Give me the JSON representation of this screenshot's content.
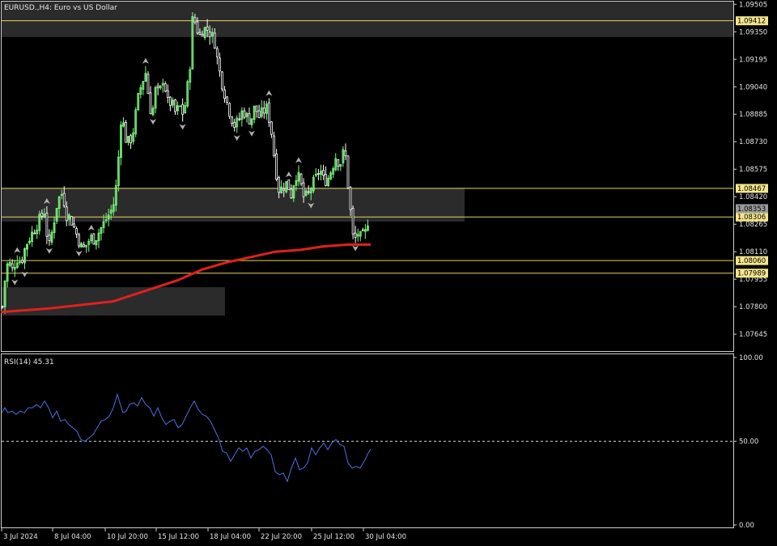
{
  "window": {
    "symbol_title": "EURUSD.,H4:  Euro vs US Dollar"
  },
  "colors": {
    "background": "#000000",
    "bull_candle": "#7CFC7C",
    "bear_candle": "#ffffff",
    "moving_average": "#e02020",
    "level_line": "#e6d36a",
    "zone_fill": "#2b2b2b",
    "rsi_line": "#4f6fe0",
    "fractal": "#b0b0b0",
    "price_tag_bg": "#f4e58c",
    "current_price_tag_bg": "#9a9a9a"
  },
  "chart_data": [
    {
      "type": "candlestick",
      "title": "EURUSD.,H4:  Euro vs US Dollar",
      "ylim": [
        1.0755,
        1.0952
      ],
      "y_ticks": [
        1.09505,
        1.0935,
        1.09195,
        1.0904,
        1.08885,
        1.0873,
        1.08575,
        1.0842,
        1.08265,
        1.0811,
        1.07955,
        1.078,
        1.07645
      ],
      "x_tick_labels": [
        "3 Jul 2024",
        "8 Jul 04:00",
        "10 Jul 20:00",
        "15 Jul 12:00",
        "18 Jul 04:00",
        "22 Jul 20:00",
        "25 Jul 12:00",
        "30 Jul 04:00"
      ],
      "price_levels": [
        1.09412,
        1.08467,
        1.08306,
        1.0806,
        1.07989
      ],
      "current_price": 1.08353,
      "zones": [
        {
          "from": 1.0932,
          "to": 1.0952
        },
        {
          "from": 1.0828,
          "to": 1.0847
        },
        {
          "from": 1.0775,
          "to": 1.0791
        }
      ],
      "series": [
        {
          "name": "",
          "close_path": [
            [
              1,
              1.0768
            ],
            [
              5,
              1.0792
            ],
            [
              10,
              1.0806
            ],
            [
              16,
              1.08
            ],
            [
              20,
              1.0808
            ],
            [
              26,
              1.0805
            ],
            [
              32,
              1.0815
            ],
            [
              38,
              1.082
            ],
            [
              44,
              1.0825
            ],
            [
              50,
              1.083
            ],
            [
              55,
              1.0834
            ],
            [
              60,
              1.0812
            ],
            [
              65,
              1.0824
            ],
            [
              70,
              1.0837
            ],
            [
              75,
              1.0844
            ],
            [
              78,
              1.0843
            ],
            [
              82,
              1.0832
            ],
            [
              87,
              1.083
            ],
            [
              92,
              1.0824
            ],
            [
              97,
              1.0818
            ],
            [
              102,
              1.0812
            ],
            [
              107,
              1.0815
            ],
            [
              112,
              1.0819
            ],
            [
              117,
              1.0818
            ],
            [
              122,
              1.0822
            ],
            [
              127,
              1.0826
            ],
            [
              132,
              1.083
            ],
            [
              137,
              1.0834
            ],
            [
              142,
              1.084
            ],
            [
              147,
              1.0868
            ],
            [
              150,
              1.089
            ],
            [
              155,
              1.0875
            ],
            [
              160,
              1.0872
            ],
            [
              165,
              1.088
            ],
            [
              170,
              1.0896
            ],
            [
              175,
              1.0906
            ],
            [
              180,
              1.0912
            ],
            [
              185,
              1.0893
            ],
            [
              188,
              1.0888
            ],
            [
              192,
              1.0902
            ],
            [
              197,
              1.09
            ],
            [
              202,
              1.091
            ],
            [
              207,
              1.0895
            ],
            [
              212,
              1.0895
            ],
            [
              217,
              1.0889
            ],
            [
              222,
              1.0893
            ],
            [
              227,
              1.0888
            ],
            [
              232,
              1.0905
            ],
            [
              236,
              1.0922
            ],
            [
              238,
              1.0943
            ],
            [
              242,
              1.094
            ],
            [
              246,
              1.0932
            ],
            [
              250,
              1.0936
            ],
            [
              255,
              1.0937
            ],
            [
              260,
              1.0934
            ],
            [
              265,
              1.093
            ],
            [
              270,
              1.0915
            ],
            [
              275,
              1.0905
            ],
            [
              280,
              1.0896
            ],
            [
              285,
              1.0888
            ],
            [
              290,
              1.0882
            ],
            [
              295,
              1.0885
            ],
            [
              300,
              1.0891
            ],
            [
              305,
              1.0887
            ],
            [
              310,
              1.0885
            ],
            [
              315,
              1.0893
            ],
            [
              320,
              1.0887
            ],
            [
              325,
              1.089
            ],
            [
              330,
              1.0892
            ],
            [
              335,
              1.088
            ],
            [
              340,
              1.086
            ],
            [
              345,
              1.0845
            ],
            [
              350,
              1.0848
            ],
            [
              355,
              1.085
            ],
            [
              360,
              1.0843
            ],
            [
              365,
              1.0855
            ],
            [
              370,
              1.0852
            ],
            [
              375,
              1.0842
            ],
            [
              380,
              1.0842
            ],
            [
              385,
              1.0848
            ],
            [
              390,
              1.0852
            ],
            [
              395,
              1.0858
            ],
            [
              400,
              1.0851
            ],
            [
              405,
              1.0852
            ],
            [
              410,
              1.0858
            ],
            [
              415,
              1.0865
            ],
            [
              420,
              1.086
            ],
            [
              425,
              1.0868
            ],
            [
              428,
              1.0862
            ],
            [
              431,
              1.0842
            ],
            [
              434,
              1.083
            ],
            [
              437,
              1.0815
            ],
            [
              440,
              1.082
            ],
            [
              443,
              1.0822
            ],
            [
              446,
              1.0818
            ],
            [
              449,
              1.082
            ],
            [
              452,
              1.0822
            ],
            [
              455,
              1.083
            ],
            [
              458,
              1.0835
            ]
          ]
        },
        {
          "name": "",
          "ma_path": [
            [
              1,
              1.0777
            ],
            [
              30,
              1.0778
            ],
            [
              60,
              1.0779
            ],
            [
              100,
              1.0781
            ],
            [
              140,
              1.0783
            ],
            [
              180,
              1.0789
            ],
            [
              220,
              1.0795
            ],
            [
              250,
              1.0801
            ],
            [
              280,
              1.0805
            ],
            [
              310,
              1.0808
            ],
            [
              340,
              1.0811
            ],
            [
              370,
              1.0812
            ],
            [
              400,
              1.0814
            ],
            [
              430,
              1.0815
            ],
            [
              458,
              1.0815
            ]
          ]
        }
      ]
    },
    {
      "type": "line",
      "title": "RSI(14) 45.31",
      "ylim": [
        0,
        100
      ],
      "y_ticks": [
        100.0,
        50.0,
        0.0
      ],
      "reference_level": 50,
      "series": [
        {
          "name": "",
          "values_path": [
            [
              2,
              67
            ],
            [
              6,
              70
            ],
            [
              10,
              67
            ],
            [
              15,
              68
            ],
            [
              20,
              66
            ],
            [
              25,
              68
            ],
            [
              30,
              67
            ],
            [
              35,
              70
            ],
            [
              40,
              70
            ],
            [
              45,
              72
            ],
            [
              50,
              70
            ],
            [
              55,
              74
            ],
            [
              60,
              70
            ],
            [
              65,
              64
            ],
            [
              70,
              68
            ],
            [
              75,
              62
            ],
            [
              80,
              63
            ],
            [
              85,
              60
            ],
            [
              90,
              58
            ],
            [
              95,
              56
            ],
            [
              100,
              51
            ],
            [
              105,
              50
            ],
            [
              110,
              52
            ],
            [
              115,
              54
            ],
            [
              120,
              58
            ],
            [
              125,
              62
            ],
            [
              130,
              63
            ],
            [
              135,
              65
            ],
            [
              140,
              70
            ],
            [
              145,
              78
            ],
            [
              148,
              73
            ],
            [
              152,
              67
            ],
            [
              156,
              68
            ],
            [
              160,
              72
            ],
            [
              165,
              73
            ],
            [
              170,
              71
            ],
            [
              175,
              76
            ],
            [
              180,
              72
            ],
            [
              185,
              70
            ],
            [
              190,
              65
            ],
            [
              195,
              70
            ],
            [
              200,
              64
            ],
            [
              205,
              60
            ],
            [
              210,
              62
            ],
            [
              215,
              63
            ],
            [
              220,
              58
            ],
            [
              225,
              60
            ],
            [
              230,
              65
            ],
            [
              235,
              70
            ],
            [
              240,
              74
            ],
            [
              245,
              69
            ],
            [
              250,
              66
            ],
            [
              255,
              65
            ],
            [
              260,
              62
            ],
            [
              265,
              57
            ],
            [
              270,
              52
            ],
            [
              275,
              44
            ],
            [
              280,
              43
            ],
            [
              285,
              38
            ],
            [
              290,
              42
            ],
            [
              295,
              46
            ],
            [
              300,
              44
            ],
            [
              305,
              46
            ],
            [
              310,
              40
            ],
            [
              315,
              44
            ],
            [
              320,
              45
            ],
            [
              325,
              47
            ],
            [
              330,
              45
            ],
            [
              335,
              42
            ],
            [
              340,
              32
            ],
            [
              345,
              30
            ],
            [
              350,
              31
            ],
            [
              355,
              26
            ],
            [
              360,
              34
            ],
            [
              365,
              40
            ],
            [
              370,
              33
            ],
            [
              375,
              34
            ],
            [
              380,
              37
            ],
            [
              385,
              46
            ],
            [
              390,
              42
            ],
            [
              395,
              46
            ],
            [
              400,
              49
            ],
            [
              405,
              45
            ],
            [
              410,
              49
            ],
            [
              415,
              51
            ],
            [
              420,
              48
            ],
            [
              425,
              47
            ],
            [
              430,
              37
            ],
            [
              435,
              34
            ],
            [
              440,
              35
            ],
            [
              445,
              34
            ],
            [
              450,
              38
            ],
            [
              455,
              43
            ],
            [
              458,
              45.31
            ]
          ]
        }
      ]
    }
  ]
}
